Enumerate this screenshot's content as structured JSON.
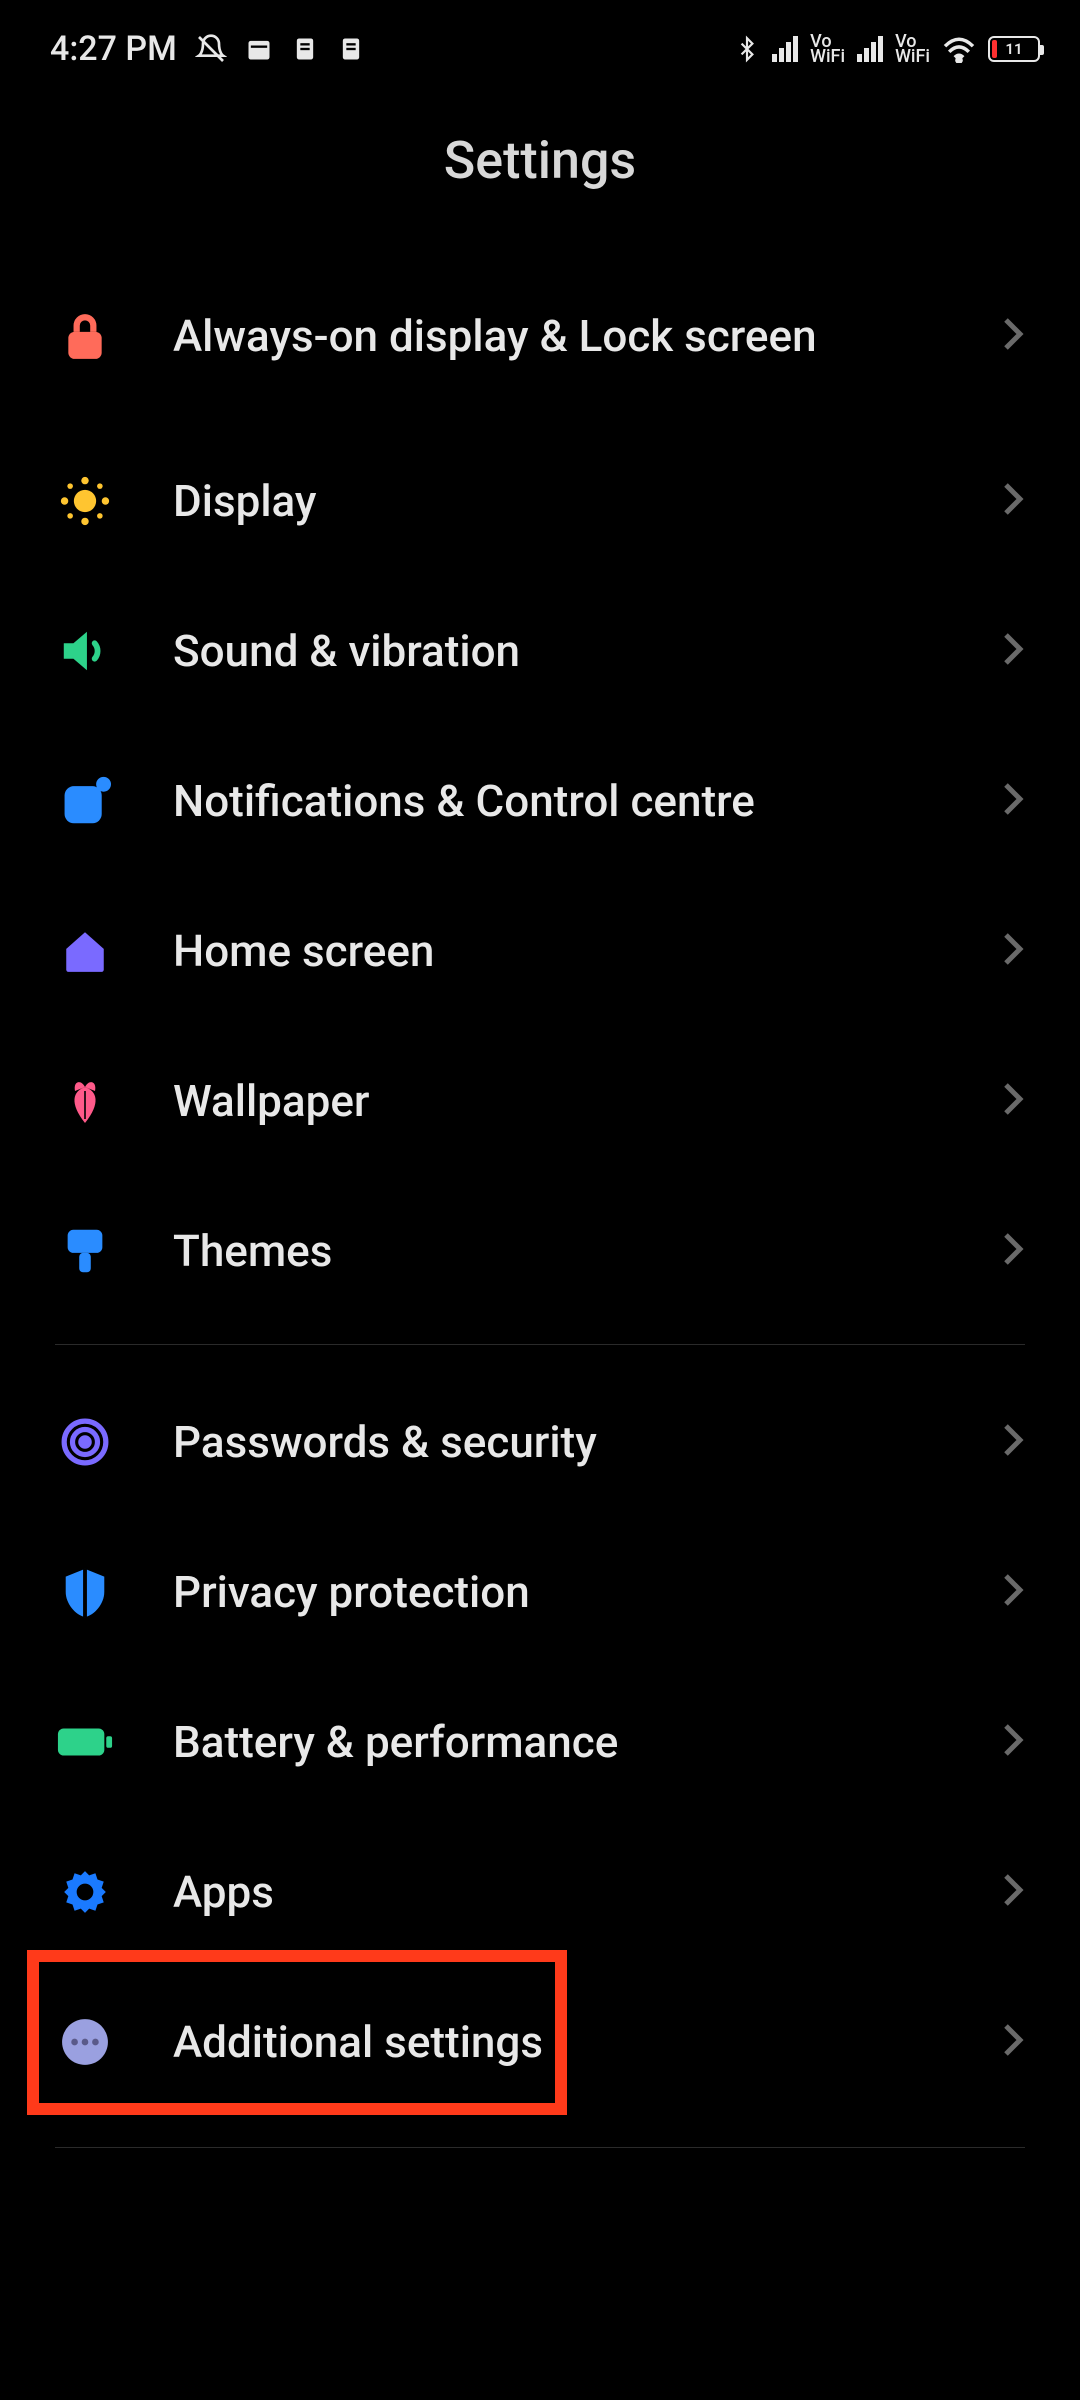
{
  "status": {
    "time": "4:27 PM",
    "battery_level": "11",
    "vowifi_label_top": "Vo",
    "vowifi_label_bottom": "WiFi"
  },
  "header": {
    "title": "Settings"
  },
  "groups": [
    {
      "items": [
        {
          "id": "always-on",
          "label": "Always-on display & Lock screen",
          "icon": "lock",
          "color": "#ff6b5a"
        },
        {
          "id": "display",
          "label": "Display",
          "icon": "sun",
          "color": "#ffc530"
        },
        {
          "id": "sound",
          "label": "Sound & vibration",
          "icon": "speaker",
          "color": "#2dd28a"
        },
        {
          "id": "notifications",
          "label": "Notifications & Control centre",
          "icon": "notify",
          "color": "#2a8cff"
        },
        {
          "id": "home",
          "label": "Home screen",
          "icon": "home",
          "color": "#7a6aff"
        },
        {
          "id": "wallpaper",
          "label": "Wallpaper",
          "icon": "flower",
          "color": "#ff5a8a"
        },
        {
          "id": "themes",
          "label": "Themes",
          "icon": "brush",
          "color": "#2a8cff"
        }
      ]
    },
    {
      "items": [
        {
          "id": "security",
          "label": "Passwords & security",
          "icon": "fingerprint",
          "color": "#7a6aff"
        },
        {
          "id": "privacy",
          "label": "Privacy protection",
          "icon": "shield",
          "color": "#2a8cff"
        },
        {
          "id": "battery",
          "label": "Battery & performance",
          "icon": "battery",
          "color": "#2dd28a"
        },
        {
          "id": "apps",
          "label": "Apps",
          "icon": "gear",
          "color": "#1a7aff",
          "highlighted": true
        },
        {
          "id": "additional",
          "label": "Additional settings",
          "icon": "dots",
          "color": "#9aa0e0"
        }
      ]
    }
  ]
}
